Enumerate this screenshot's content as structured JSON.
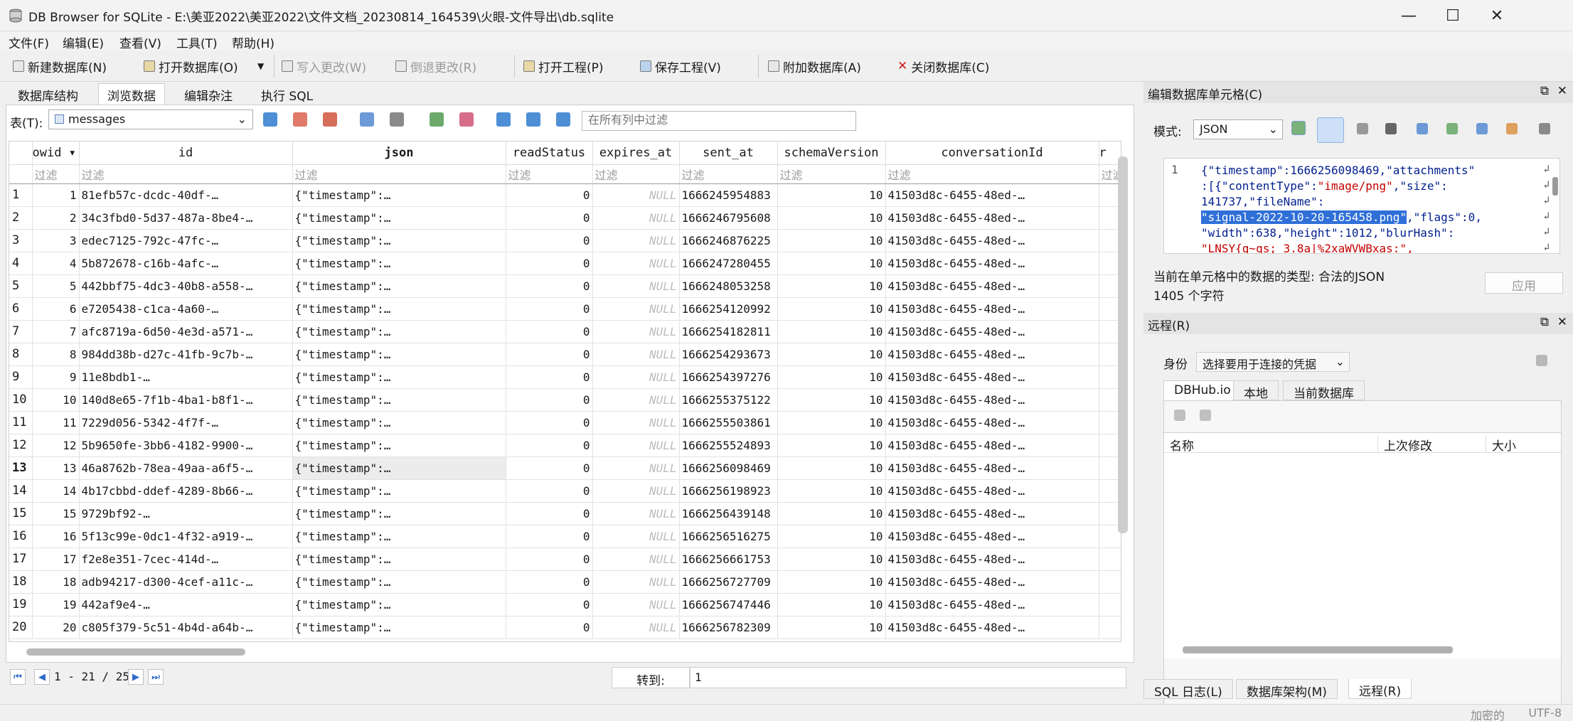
{
  "window": {
    "title": "DB Browser for SQLite - E:\\美亚2022\\美亚2022\\文件文档_20230814_164539\\火眼-文件导出\\db.sqlite",
    "minimize": "—",
    "maximize": "☐",
    "close": "✕"
  },
  "menu": [
    "文件(F)",
    "编辑(E)",
    "查看(V)",
    "工具(T)",
    "帮助(H)"
  ],
  "toolbar": {
    "new_db": "新建数据库(N)",
    "open_db": "打开数据库(O)",
    "write_changes": "写入更改(W)",
    "revert_changes": "倒退更改(R)",
    "open_project": "打开工程(P)",
    "save_project": "保存工程(V)",
    "attach_db": "附加数据库(A)",
    "close_db": "关闭数据库(C)"
  },
  "tabs": [
    "数据库结构",
    "浏览数据",
    "编辑杂注",
    "执行 SQL"
  ],
  "browse": {
    "table_label": "表(T):",
    "table_name": "messages",
    "filter_placeholder": "在所有列中过滤",
    "filter_text": "过滤",
    "columns": [
      "owid ▾",
      "id",
      "json",
      "readStatus",
      "expires_at",
      "sent_at",
      "schemaVersion",
      "conversationId",
      "r"
    ],
    "rows": [
      {
        "n": "1",
        "rowid": "1",
        "id": "81efb57c-dcdc-40df-…",
        "json": "{\"timestamp\":…",
        "readStatus": "0",
        "expires": "NULL",
        "sent_at": "1666245954883",
        "schema": "10",
        "conv": "41503d8c-6455-48ed-…"
      },
      {
        "n": "2",
        "rowid": "2",
        "id": "34c3fbd0-5d37-487a-8be4-…",
        "json": "{\"timestamp\":…",
        "readStatus": "0",
        "expires": "NULL",
        "sent_at": "1666246795608",
        "schema": "10",
        "conv": "41503d8c-6455-48ed-…"
      },
      {
        "n": "3",
        "rowid": "3",
        "id": "edec7125-792c-47fc-…",
        "json": "{\"timestamp\":…",
        "readStatus": "0",
        "expires": "NULL",
        "sent_at": "1666246876225",
        "schema": "10",
        "conv": "41503d8c-6455-48ed-…"
      },
      {
        "n": "4",
        "rowid": "4",
        "id": "5b872678-c16b-4afc-…",
        "json": "{\"timestamp\":…",
        "readStatus": "0",
        "expires": "NULL",
        "sent_at": "1666247280455",
        "schema": "10",
        "conv": "41503d8c-6455-48ed-…"
      },
      {
        "n": "5",
        "rowid": "5",
        "id": "442bbf75-4dc3-40b8-a558-…",
        "json": "{\"timestamp\":…",
        "readStatus": "0",
        "expires": "NULL",
        "sent_at": "1666248053258",
        "schema": "10",
        "conv": "41503d8c-6455-48ed-…"
      },
      {
        "n": "6",
        "rowid": "6",
        "id": "e7205438-c1ca-4a60-…",
        "json": "{\"timestamp\":…",
        "readStatus": "0",
        "expires": "NULL",
        "sent_at": "1666254120992",
        "schema": "10",
        "conv": "41503d8c-6455-48ed-…"
      },
      {
        "n": "7",
        "rowid": "7",
        "id": "afc8719a-6d50-4e3d-a571-…",
        "json": "{\"timestamp\":…",
        "readStatus": "0",
        "expires": "NULL",
        "sent_at": "1666254182811",
        "schema": "10",
        "conv": "41503d8c-6455-48ed-…"
      },
      {
        "n": "8",
        "rowid": "8",
        "id": "984dd38b-d27c-41fb-9c7b-…",
        "json": "{\"timestamp\":…",
        "readStatus": "0",
        "expires": "NULL",
        "sent_at": "1666254293673",
        "schema": "10",
        "conv": "41503d8c-6455-48ed-…"
      },
      {
        "n": "9",
        "rowid": "9",
        "id": "11e8bdb1-…",
        "json": "{\"timestamp\":…",
        "readStatus": "0",
        "expires": "NULL",
        "sent_at": "1666254397276",
        "schema": "10",
        "conv": "41503d8c-6455-48ed-…"
      },
      {
        "n": "10",
        "rowid": "10",
        "id": "140d8e65-7f1b-4ba1-b8f1-…",
        "json": "{\"timestamp\":…",
        "readStatus": "0",
        "expires": "NULL",
        "sent_at": "1666255375122",
        "schema": "10",
        "conv": "41503d8c-6455-48ed-…"
      },
      {
        "n": "11",
        "rowid": "11",
        "id": "7229d056-5342-4f7f-…",
        "json": "{\"timestamp\":…",
        "readStatus": "0",
        "expires": "NULL",
        "sent_at": "1666255503861",
        "schema": "10",
        "conv": "41503d8c-6455-48ed-…"
      },
      {
        "n": "12",
        "rowid": "12",
        "id": "5b9650fe-3bb6-4182-9900-…",
        "json": "{\"timestamp\":…",
        "readStatus": "0",
        "expires": "NULL",
        "sent_at": "1666255524893",
        "schema": "10",
        "conv": "41503d8c-6455-48ed-…"
      },
      {
        "n": "13",
        "rowid": "13",
        "id": "46a8762b-78ea-49aa-a6f5-…",
        "json": "{\"timestamp\":…",
        "readStatus": "0",
        "expires": "NULL",
        "sent_at": "1666256098469",
        "schema": "10",
        "conv": "41503d8c-6455-48ed-…"
      },
      {
        "n": "14",
        "rowid": "14",
        "id": "4b17cbbd-ddef-4289-8b66-…",
        "json": "{\"timestamp\":…",
        "readStatus": "0",
        "expires": "NULL",
        "sent_at": "1666256198923",
        "schema": "10",
        "conv": "41503d8c-6455-48ed-…"
      },
      {
        "n": "15",
        "rowid": "15",
        "id": "9729bf92-…",
        "json": "{\"timestamp\":…",
        "readStatus": "0",
        "expires": "NULL",
        "sent_at": "1666256439148",
        "schema": "10",
        "conv": "41503d8c-6455-48ed-…"
      },
      {
        "n": "16",
        "rowid": "16",
        "id": "5f13c99e-0dc1-4f32-a919-…",
        "json": "{\"timestamp\":…",
        "readStatus": "0",
        "expires": "NULL",
        "sent_at": "1666256516275",
        "schema": "10",
        "conv": "41503d8c-6455-48ed-…"
      },
      {
        "n": "17",
        "rowid": "17",
        "id": "f2e8e351-7cec-414d-…",
        "json": "{\"timestamp\":…",
        "readStatus": "0",
        "expires": "NULL",
        "sent_at": "1666256661753",
        "schema": "10",
        "conv": "41503d8c-6455-48ed-…"
      },
      {
        "n": "18",
        "rowid": "18",
        "id": "adb94217-d300-4cef-a11c-…",
        "json": "{\"timestamp\":…",
        "readStatus": "0",
        "expires": "NULL",
        "sent_at": "1666256727709",
        "schema": "10",
        "conv": "41503d8c-6455-48ed-…"
      },
      {
        "n": "19",
        "rowid": "19",
        "id": "442af9e4-…",
        "json": "{\"timestamp\":…",
        "readStatus": "0",
        "expires": "NULL",
        "sent_at": "1666256747446",
        "schema": "10",
        "conv": "41503d8c-6455-48ed-…"
      },
      {
        "n": "20",
        "rowid": "20",
        "id": "c805f379-5c51-4b4d-a64b-…",
        "json": "{\"timestamp\":…",
        "readStatus": "0",
        "expires": "NULL",
        "sent_at": "1666256782309",
        "schema": "10",
        "conv": "41503d8c-6455-48ed-…"
      }
    ],
    "selected_row": 13,
    "pager": {
      "range": "1 - 21 / 25",
      "goto_label": "转到:",
      "goto_value": "1"
    }
  },
  "edit_cell": {
    "title": "编辑数据库单元格(C)",
    "mode_label": "模式:",
    "mode_value": "JSON",
    "line_no": "1",
    "code_lines": [
      [
        "{\"timestamp\":1666256098469,\"attachments\"",
        "",
        ""
      ],
      [
        ":[{\"contentType\":",
        "\"image/png\"",
        ",\"size\":"
      ],
      [
        "141737,\"fileName\":",
        "",
        ""
      ],
      [
        "",
        "\"signal-2022-10-20-165458.png\"",
        ",\"flags\":0,"
      ],
      [
        "\"width\":638,\"height\":1012,\"blurHash\":",
        "",
        ""
      ],
      [
        "",
        "\"LNSY{q~qs;_3.8a|%2xaWVWBxas:\",",
        ""
      ]
    ],
    "type_info": "当前在单元格中的数据的类型: 合法的JSON",
    "char_count": "1405 个字符",
    "apply": "应用"
  },
  "remote": {
    "title": "远程(R)",
    "identity_label": "身份",
    "identity_value": "选择要用于连接的凭据",
    "tabs": [
      "DBHub.io",
      "本地",
      "当前数据库"
    ],
    "columns": [
      "名称",
      "上次修改",
      "大小"
    ]
  },
  "bottom_tabs": [
    "SQL 日志(L)",
    "数据库架构(M)",
    "远程(R)"
  ],
  "status": {
    "encoding": "UTF-8",
    "encryption": "加密的"
  },
  "colors": {
    "accent": "#2f6fd8",
    "toolbar_bg": "#f0f0f0"
  }
}
